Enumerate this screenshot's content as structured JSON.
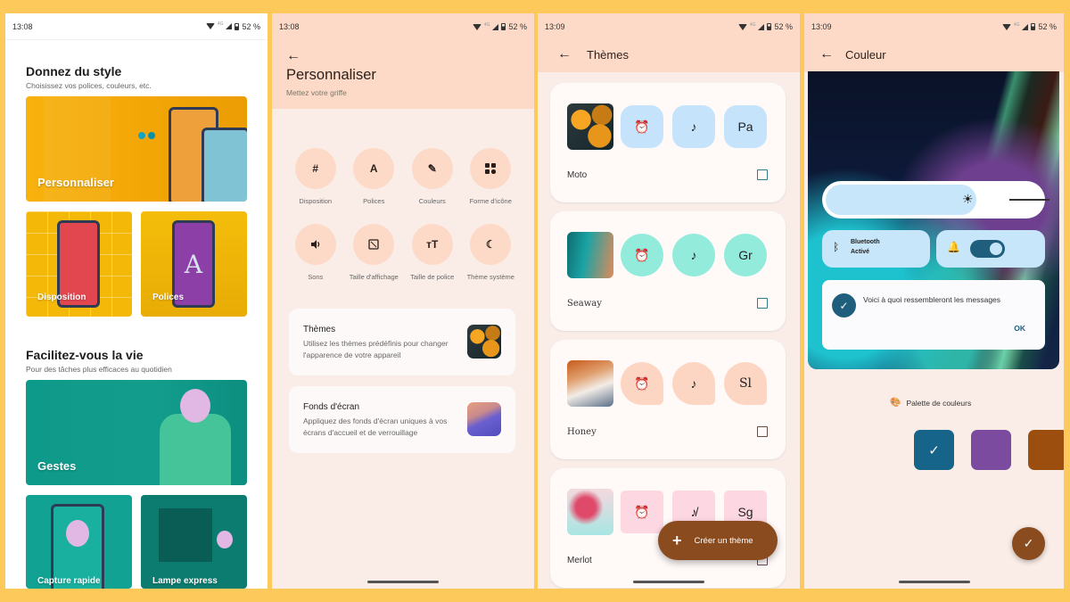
{
  "status_bar": {
    "battery": "52 %",
    "network": "4G"
  },
  "screen1": {
    "time": "13:08",
    "section1": {
      "title": "Donnez du style",
      "subtitle": "Choisissez vos polices, couleurs, etc.",
      "tiles": [
        "Personnaliser",
        "Disposition",
        "Polices"
      ]
    },
    "section2": {
      "title": "Facilitez-vous la vie",
      "subtitle": "Pour des tâches plus efficaces au quotidien",
      "tiles": [
        "Gestes",
        "Capture rapide",
        "Lampe express"
      ]
    },
    "polices_glyph": "A"
  },
  "screen2": {
    "time": "13:08",
    "title": "Personnaliser",
    "subtitle": "Mettez votre griffe",
    "grid": [
      {
        "label": "Disposition",
        "icon": "grid-icon",
        "glyph": "#"
      },
      {
        "label": "Polices",
        "icon": "font-icon",
        "glyph": "A"
      },
      {
        "label": "Couleurs",
        "icon": "eyedropper-icon",
        "glyph": "✎"
      },
      {
        "label": "Forme d'icône",
        "icon": "icon-shape-icon",
        "glyph": "▪▪"
      },
      {
        "label": "Sons",
        "icon": "speaker-icon",
        "glyph": "🔈"
      },
      {
        "label": "Taille d'affichage",
        "icon": "display-size-icon",
        "glyph": "⬚"
      },
      {
        "label": "Taille de police",
        "icon": "font-size-icon",
        "glyph": "ᴛT"
      },
      {
        "label": "Thème système",
        "icon": "moon-icon",
        "glyph": "☾"
      }
    ],
    "options": [
      {
        "title": "Thèmes",
        "description": "Utilisez les thèmes prédéfinis pour changer l'apparence de votre appareil"
      },
      {
        "title": "Fonds d'écran",
        "description": "Appliquez des fonds d'écran uniques à vos écrans d'accueil et de verrouillage"
      }
    ]
  },
  "screen3": {
    "time": "13:09",
    "title": "Thèmes",
    "themes": [
      {
        "name": "Moto",
        "font_sample": "Pa",
        "chip_color": "#c5e4fb",
        "checked": false
      },
      {
        "name": "Seaway",
        "font_sample": "Gr",
        "chip_color": "#93ecdb",
        "checked": false
      },
      {
        "name": "Honey",
        "font_sample": "Sl",
        "chip_color": "#fdd6c3",
        "checked": false
      },
      {
        "name": "Merlot",
        "font_sample": "Sg",
        "chip_color": "#fdd7e2",
        "checked": false
      }
    ],
    "icons": {
      "alarm": "⏰",
      "music": "♪",
      "music_off": "♪̸"
    },
    "fab_label": "Créer un thème",
    "fab_glyph": "+"
  },
  "screen4": {
    "time": "13:09",
    "title": "Couleur",
    "brightness_level": 0.7,
    "bluetooth": {
      "name": "Bluetooth",
      "status": "Activé"
    },
    "dnd_toggle_on": true,
    "message_preview": "Voici à quoi ressembleront les messages",
    "ok_label": "OK",
    "palette_label": "Palette de couleurs",
    "swatches": [
      {
        "color": "#17648a",
        "selected": true
      },
      {
        "color": "#7a4b9f",
        "selected": false
      },
      {
        "color": "#9c4e0e",
        "selected": false
      }
    ],
    "check_glyph": "✓"
  },
  "colors": {
    "background": "#fdc95a",
    "accent_brown": "#8a4b1e",
    "header_peach": "#fddac7",
    "surface": "#faede8",
    "qs_blue": "#c7e6f9",
    "toggle_blue": "#1f5e7d"
  }
}
